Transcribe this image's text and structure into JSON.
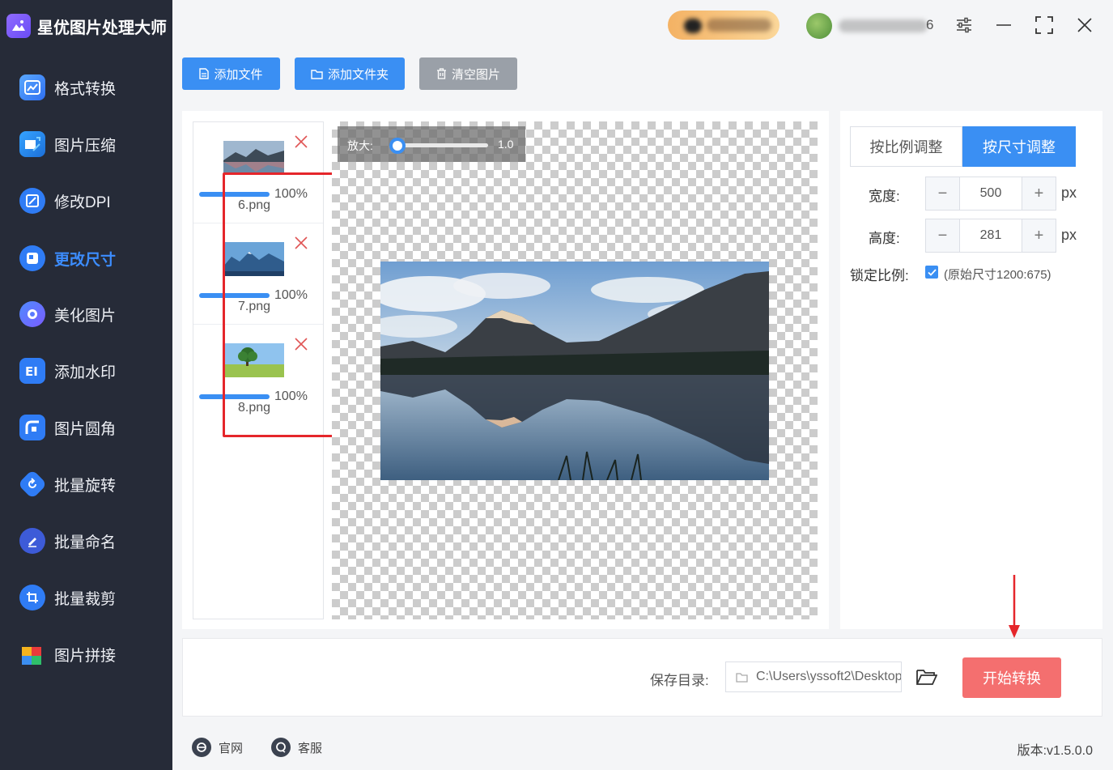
{
  "app": {
    "title": "星优图片处理大师"
  },
  "user": {
    "name_suffix": "6"
  },
  "sidebar": {
    "items": [
      {
        "label": "格式转换",
        "icon": "format-convert-icon"
      },
      {
        "label": "图片压缩",
        "icon": "compress-icon"
      },
      {
        "label": "修改DPI",
        "icon": "dpi-icon"
      },
      {
        "label": "更改尺寸",
        "icon": "resize-icon",
        "active": true
      },
      {
        "label": "美化图片",
        "icon": "beautify-icon"
      },
      {
        "label": "添加水印",
        "icon": "watermark-icon"
      },
      {
        "label": "图片圆角",
        "icon": "round-corner-icon"
      },
      {
        "label": "批量旋转",
        "icon": "rotate-icon"
      },
      {
        "label": "批量命名",
        "icon": "rename-icon"
      },
      {
        "label": "批量裁剪",
        "icon": "crop-icon"
      },
      {
        "label": "图片拼接",
        "icon": "stitch-icon"
      }
    ]
  },
  "toolbar": {
    "add_file": "添加文件",
    "add_folder": "添加文件夹",
    "clear_images": "清空图片"
  },
  "files": [
    {
      "name": "6.png",
      "progress_label": "100%",
      "progress": 1.0
    },
    {
      "name": "7.png",
      "progress_label": "100%",
      "progress": 1.0
    },
    {
      "name": "8.png",
      "progress_label": "100%",
      "progress": 1.0
    }
  ],
  "preview": {
    "zoom_label": "放大:",
    "zoom_value": "1.0"
  },
  "settings": {
    "tab_ratio": "按比例调整",
    "tab_size": "按尺寸调整",
    "width_label": "宽度:",
    "width_value": "500",
    "height_label": "高度:",
    "height_value": "281",
    "unit": "px",
    "lock_label": "锁定比例:",
    "lock_checked": true,
    "original_size": "(原始尺寸1200:675)"
  },
  "output": {
    "save_label": "保存目录:",
    "save_path": "C:\\Users\\yssoft2\\Desktop",
    "start_button": "开始转换"
  },
  "footer": {
    "website": "官网",
    "support": "客服",
    "version": "版本:v1.5.0.0"
  },
  "colors": {
    "accent": "#3a8ff3",
    "start": "#f46f6f",
    "sidebar": "#262b38",
    "annotation": "#e5262b"
  }
}
